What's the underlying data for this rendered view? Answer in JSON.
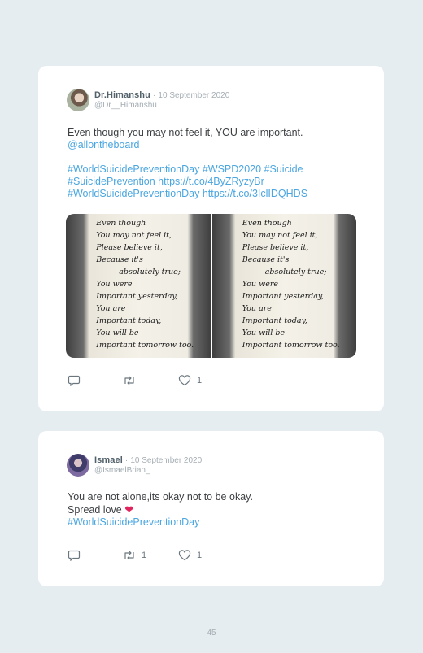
{
  "tweets": [
    {
      "name": "Dr.Himanshu",
      "separator": "·",
      "date": "10 September 2020",
      "handle": "@Dr__Himanshu",
      "lines": [
        {
          "text": "Even though you may not feel it, YOU are important.",
          "link": false
        },
        {
          "text": "@allontheboard",
          "link": true
        },
        {
          "text": "",
          "link": false
        },
        {
          "text": "#WorldSuicidePreventionDay #WSPD2020 #Suicide",
          "link": true
        },
        {
          "text": "#SuicidePrevention https://t.co/4ByZRyzyBr",
          "link": true
        },
        {
          "text": "#WorldSuicidePreventionDay https://t.co/3IclIDQHDS",
          "link": true
        }
      ],
      "note_lines": [
        "Even though",
        "You may not feel it,",
        "Please believe it,",
        "Because it's",
        "absolutely true;",
        "You were",
        "Important yesterday,",
        "You are",
        "Important today,",
        "You will be",
        "Important tomorrow too."
      ],
      "retweets": "",
      "likes": "1"
    },
    {
      "name": "Ismael",
      "separator": "·",
      "date": "10 September 2020",
      "handle": "@IsmaelBrian_",
      "line1": "You are not alone,its okay not to be okay.",
      "line2": "Spread love",
      "heart": "❤",
      "hashtag": "#WorldSuicidePreventionDay",
      "retweets": "1",
      "likes": "1"
    }
  ],
  "page_number": "45",
  "colors": {
    "link": "#4aa6e0",
    "heart": "#e0245e",
    "background": "#e6edf0"
  },
  "icons": {
    "reply": "reply-icon",
    "retweet": "retweet-icon",
    "like": "heart-icon"
  }
}
